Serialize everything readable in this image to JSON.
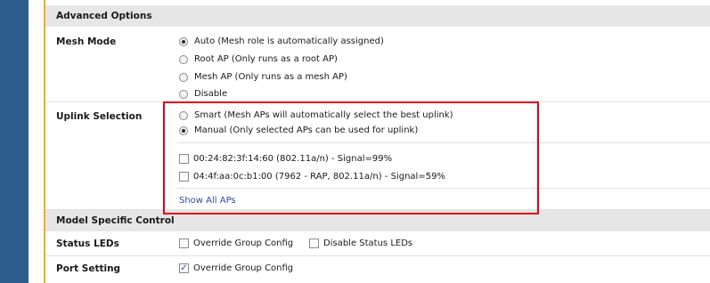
{
  "advanced": {
    "title": "Advanced Options"
  },
  "mesh_mode": {
    "label": "Mesh Mode",
    "options": [
      {
        "label": "Auto (Mesh role is automatically assigned)",
        "selected": true
      },
      {
        "label": "Root AP (Only runs as a root AP)",
        "selected": false
      },
      {
        "label": "Mesh AP (Only runs as a mesh AP)",
        "selected": false
      },
      {
        "label": "Disable",
        "selected": false
      }
    ]
  },
  "uplink": {
    "label": "Uplink Selection",
    "options": [
      {
        "label": "Smart (Mesh APs will automatically select the best uplink)",
        "selected": false
      },
      {
        "label": "Manual (Only selected APs can be used for uplink)",
        "selected": true
      }
    ],
    "aps": [
      {
        "label": "00:24:82:3f:14:60 (802.11a/n) - Signal=99%",
        "checked": false
      },
      {
        "label": "04:4f:aa:0c:b1:00 (7962 - RAP, 802.11a/n) - Signal=59%",
        "checked": false
      }
    ],
    "show_all": "Show All APs"
  },
  "model": {
    "title": "Model Specific Control"
  },
  "status_leds": {
    "label": "Status LEDs",
    "override": {
      "label": "Override Group Config",
      "checked": false
    },
    "disable": {
      "label": "Disable Status LEDs",
      "checked": false
    }
  },
  "port_setting": {
    "label": "Port Setting",
    "override": {
      "label": "Override Group Config",
      "checked": true
    }
  },
  "colors": {
    "sidebar": "#2c5e8c",
    "highlight": "#e0001a",
    "accent": "#f0a830",
    "link": "#2a4f99",
    "header_bg": "#e6e6e6"
  }
}
